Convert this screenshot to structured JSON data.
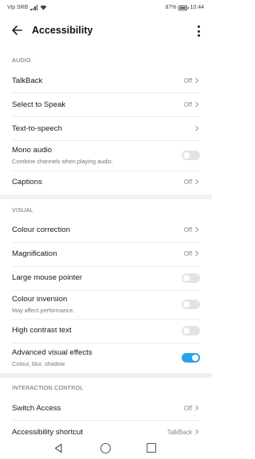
{
  "status": {
    "carrier": "Vip SRB",
    "battery": "87%",
    "time": "10:44"
  },
  "title": "Accessibility",
  "sections": {
    "audio": "AUDIO",
    "visual": "VISUAL",
    "interaction": "INTERACTION CONTROL"
  },
  "items": {
    "talkback": {
      "label": "TalkBack",
      "value": "Off"
    },
    "select_to_speak": {
      "label": "Select to Speak",
      "value": "Off"
    },
    "tts": {
      "label": "Text-to-speech"
    },
    "mono": {
      "label": "Mono audio",
      "sub": "Combine channels when playing audio.",
      "on": false
    },
    "captions": {
      "label": "Captions",
      "value": "Off"
    },
    "colour_correction": {
      "label": "Colour correction",
      "value": "Off"
    },
    "magnification": {
      "label": "Magnification",
      "value": "Off"
    },
    "large_pointer": {
      "label": "Large mouse pointer",
      "on": false
    },
    "colour_inversion": {
      "label": "Colour inversion",
      "sub": "May affect performance.",
      "on": false
    },
    "high_contrast": {
      "label": "High contrast text",
      "on": false
    },
    "advanced_effects": {
      "label": "Advanced visual effects",
      "sub": "Colour, blur, shadow",
      "on": true
    },
    "switch_access": {
      "label": "Switch Access",
      "value": "Off"
    },
    "shortcut": {
      "label": "Accessibility shortcut",
      "value": "TalkBack"
    }
  },
  "colors": {
    "accent": "#2aa0e6",
    "switch_off": "#e3e3e3"
  },
  "icons": [
    "wifi-icon",
    "signal-icon",
    "battery-icon",
    "back-arrow-icon",
    "more-icon",
    "chevron-right-icon",
    "nav-back-icon",
    "nav-home-icon",
    "nav-recents-icon"
  ]
}
